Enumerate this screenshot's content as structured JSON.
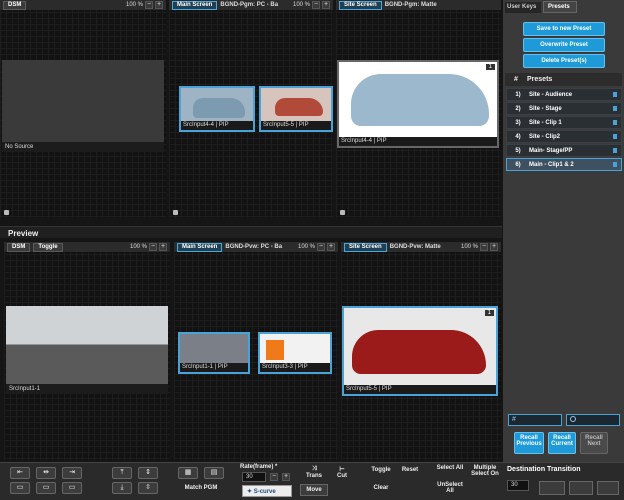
{
  "program": {
    "panes": [
      {
        "tab": "DSM",
        "title": "",
        "zoom": "100 %"
      },
      {
        "tab": "Main Screen",
        "title": "BGND-Pgm: PC - Ba",
        "zoom": "100 %"
      },
      {
        "tab": "Site Screen",
        "title": "BGND-Pgm: Matte",
        "zoom": ""
      }
    ],
    "no_source": "No Source",
    "win_pgm_a": "SrcInput4-4 | PIP",
    "win_pgm_b": "SrcInput5-5 | PIP",
    "win_pgm_c": "SrcInput4-4 | PIP",
    "t_a": "T",
    "t_b": "T",
    "badge": "1"
  },
  "preview": {
    "title": "Preview",
    "panes": [
      {
        "tab": "DSM",
        "extra": "Toggle",
        "zoom": "100 %"
      },
      {
        "tab": "Main Screen",
        "title": "BGND-Pvw: PC - Ba",
        "zoom": "100 %"
      },
      {
        "tab": "Site Screen",
        "title": "BGND-Pvw: Matte",
        "zoom": "100 %"
      }
    ],
    "src_big": "SrcInput1-1",
    "win_a": "SrcInput1-1 | PIP",
    "win_b": "SrcInput3-3 | PIP",
    "win_c": "SrcInput5-5 | PIP",
    "badge": "1"
  },
  "side": {
    "tabs": [
      "User Keys",
      "Presets"
    ],
    "save": "Save to new Preset",
    "overwrite": "Overwrite Preset",
    "delete": "Delete Preset(s)",
    "hash": "#",
    "presets_header": "Presets",
    "presets": [
      {
        "num": "1)",
        "name": "Site - Audience"
      },
      {
        "num": "2)",
        "name": "Site - Stage"
      },
      {
        "num": "3)",
        "name": "Site - Clip 1"
      },
      {
        "num": "4)",
        "name": "Site - Clip2"
      },
      {
        "num": "5)",
        "name": "Main- Stage/PP"
      },
      {
        "num": "6)",
        "name": "Main - Clip1 & 2"
      }
    ],
    "search_hash": "#",
    "recall_prev": "Recall Previous",
    "recall_cur": "Recall Current",
    "recall_next": "Recall Next",
    "dest_transition": "Destination Transition",
    "dest_value": "30"
  },
  "toolbar": {
    "match_pgm": "Match PGM",
    "rate_label": "Rate(frame) *",
    "rate_value": "30",
    "scurve": "S-curve",
    "trans": "Trans",
    "cut": "Cut",
    "move": "Move",
    "toggle": "Toggle",
    "reset": "Reset",
    "clear": "Clear",
    "select_all": "Select All",
    "unselect_all": "UnSelect All",
    "multiple": "Multiple Select On",
    "minus": "−",
    "plus": "+"
  }
}
